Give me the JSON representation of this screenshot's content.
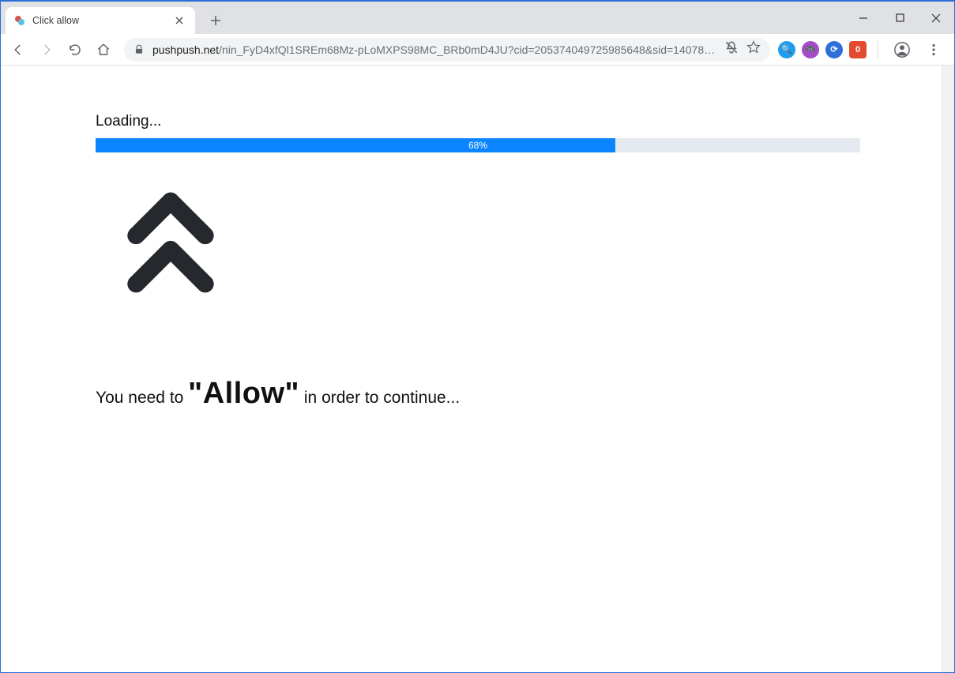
{
  "window": {
    "tab_title": "Click allow",
    "url_host": "pushpush.net",
    "url_path": "/nin_FyD4xfQl1SREm68Mz-pLoMXPS98MC_BRb0mD4JU?cid=205374049725985648&sid=1407888&utm…"
  },
  "page": {
    "loading_label": "Loading...",
    "progress_percent": 68,
    "progress_text": "68%",
    "message_prefix": "You need to ",
    "message_highlight": "\"Allow\"",
    "message_suffix": " in order to continue..."
  },
  "colors": {
    "progress_fill": "#0a84ff",
    "progress_track": "#e5eaf0",
    "arrow": "#25282c"
  },
  "extensions": [
    {
      "bg": "#209cee",
      "glyph": "🔍"
    },
    {
      "bg": "#a44cc7",
      "glyph": "🎮"
    },
    {
      "bg": "#2e6fd9",
      "glyph": "⟳"
    },
    {
      "bg": "#e34b2e",
      "glyph": "0"
    }
  ]
}
